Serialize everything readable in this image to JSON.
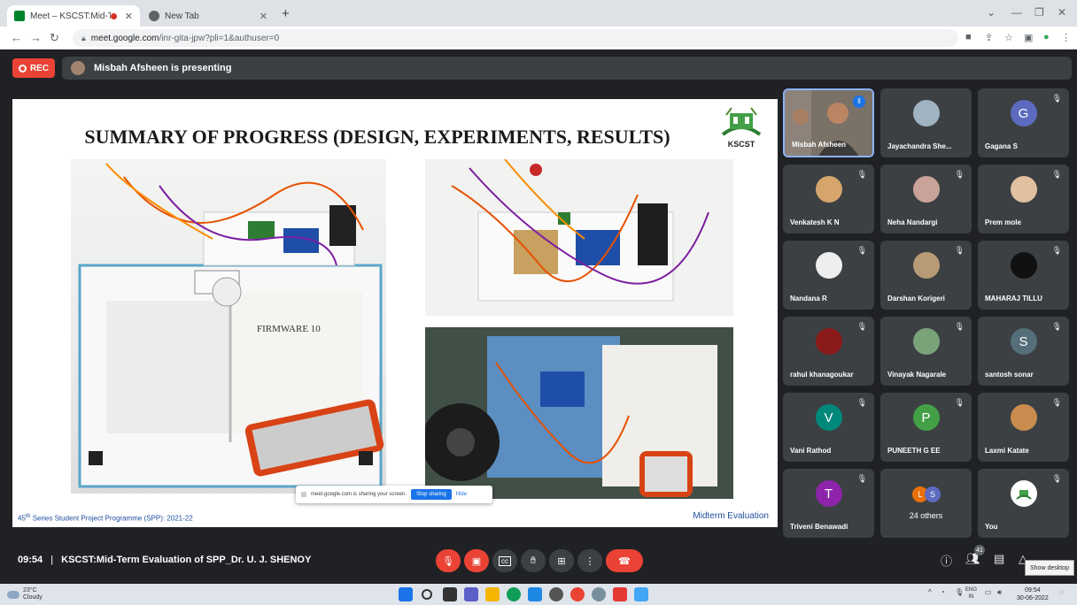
{
  "browser": {
    "tabs": [
      {
        "title": "Meet – KSCST:Mid-Term Eva",
        "recording": true
      },
      {
        "title": "New Tab"
      }
    ],
    "url_host": "meet.google.com",
    "url_path": "/inr-gita-jpw?pli=1&authuser=0"
  },
  "meet": {
    "rec_label": "REC",
    "presenting_text": "Misbah Afsheen is presenting",
    "time": "09:54",
    "separator": "|",
    "meeting_title": "KSCST:Mid-Term Evaluation of SPP_Dr. U. J. SHENOY",
    "people_count": "41",
    "tooltip": "Show desktop"
  },
  "slide": {
    "title": "SUMMARY OF PROGRESS (DESIGN, EXPERIMENTS, RESULTS)",
    "logo_text": "KSCST",
    "book_label": "FIRMWARE 10",
    "footer_left_prefix": "45",
    "footer_left_sup": "th",
    "footer_left_rest": " Series Student Project Programme (SPP): 2021-22",
    "footer_right": "Midterm Evaluation",
    "share_text": "meet.google.com is sharing your screen.",
    "stop_sharing": "Stop sharing",
    "hide": "Hide"
  },
  "participants": [
    {
      "name": "Misbah Afsheen",
      "video": true
    },
    {
      "name": "Jayachandra She...",
      "avatar": "photo"
    },
    {
      "name": "Gagana S",
      "letter": "G",
      "color": "#5c6bc0"
    },
    {
      "name": "Venkatesh K N",
      "avatar": "photo"
    },
    {
      "name": "Neha Nandargi",
      "avatar": "photo"
    },
    {
      "name": "Prem mole",
      "avatar": "photo"
    },
    {
      "name": "Nandana R",
      "avatar": "photo"
    },
    {
      "name": "Darshan Korigeri",
      "avatar": "photo"
    },
    {
      "name": "MAHARAJ TILLU",
      "avatar": "photo"
    },
    {
      "name": "rahul khanagoukar",
      "avatar": "photo"
    },
    {
      "name": "Vinayak Nagarale",
      "avatar": "photo"
    },
    {
      "name": "santosh sonar",
      "letter": "S",
      "color": "#546e7a"
    },
    {
      "name": "Vani Rathod",
      "letter": "V",
      "color": "#00897b"
    },
    {
      "name": "PUNEETH G EE",
      "letter": "P",
      "color": "#43a047"
    },
    {
      "name": "Laxmi Katate",
      "avatar": "photo"
    },
    {
      "name": "Triveni Benawadi",
      "letter": "T",
      "color": "#8e24aa"
    },
    {
      "name": "24 others",
      "letters": [
        "L",
        "S"
      ]
    },
    {
      "name": "You",
      "avatar": "logo"
    }
  ],
  "taskbar": {
    "temp": "23°C",
    "weather": "Cloudy",
    "lang1": "ENG",
    "lang2": "IN",
    "clock_time": "09:54",
    "clock_date": "30-06-2022"
  }
}
